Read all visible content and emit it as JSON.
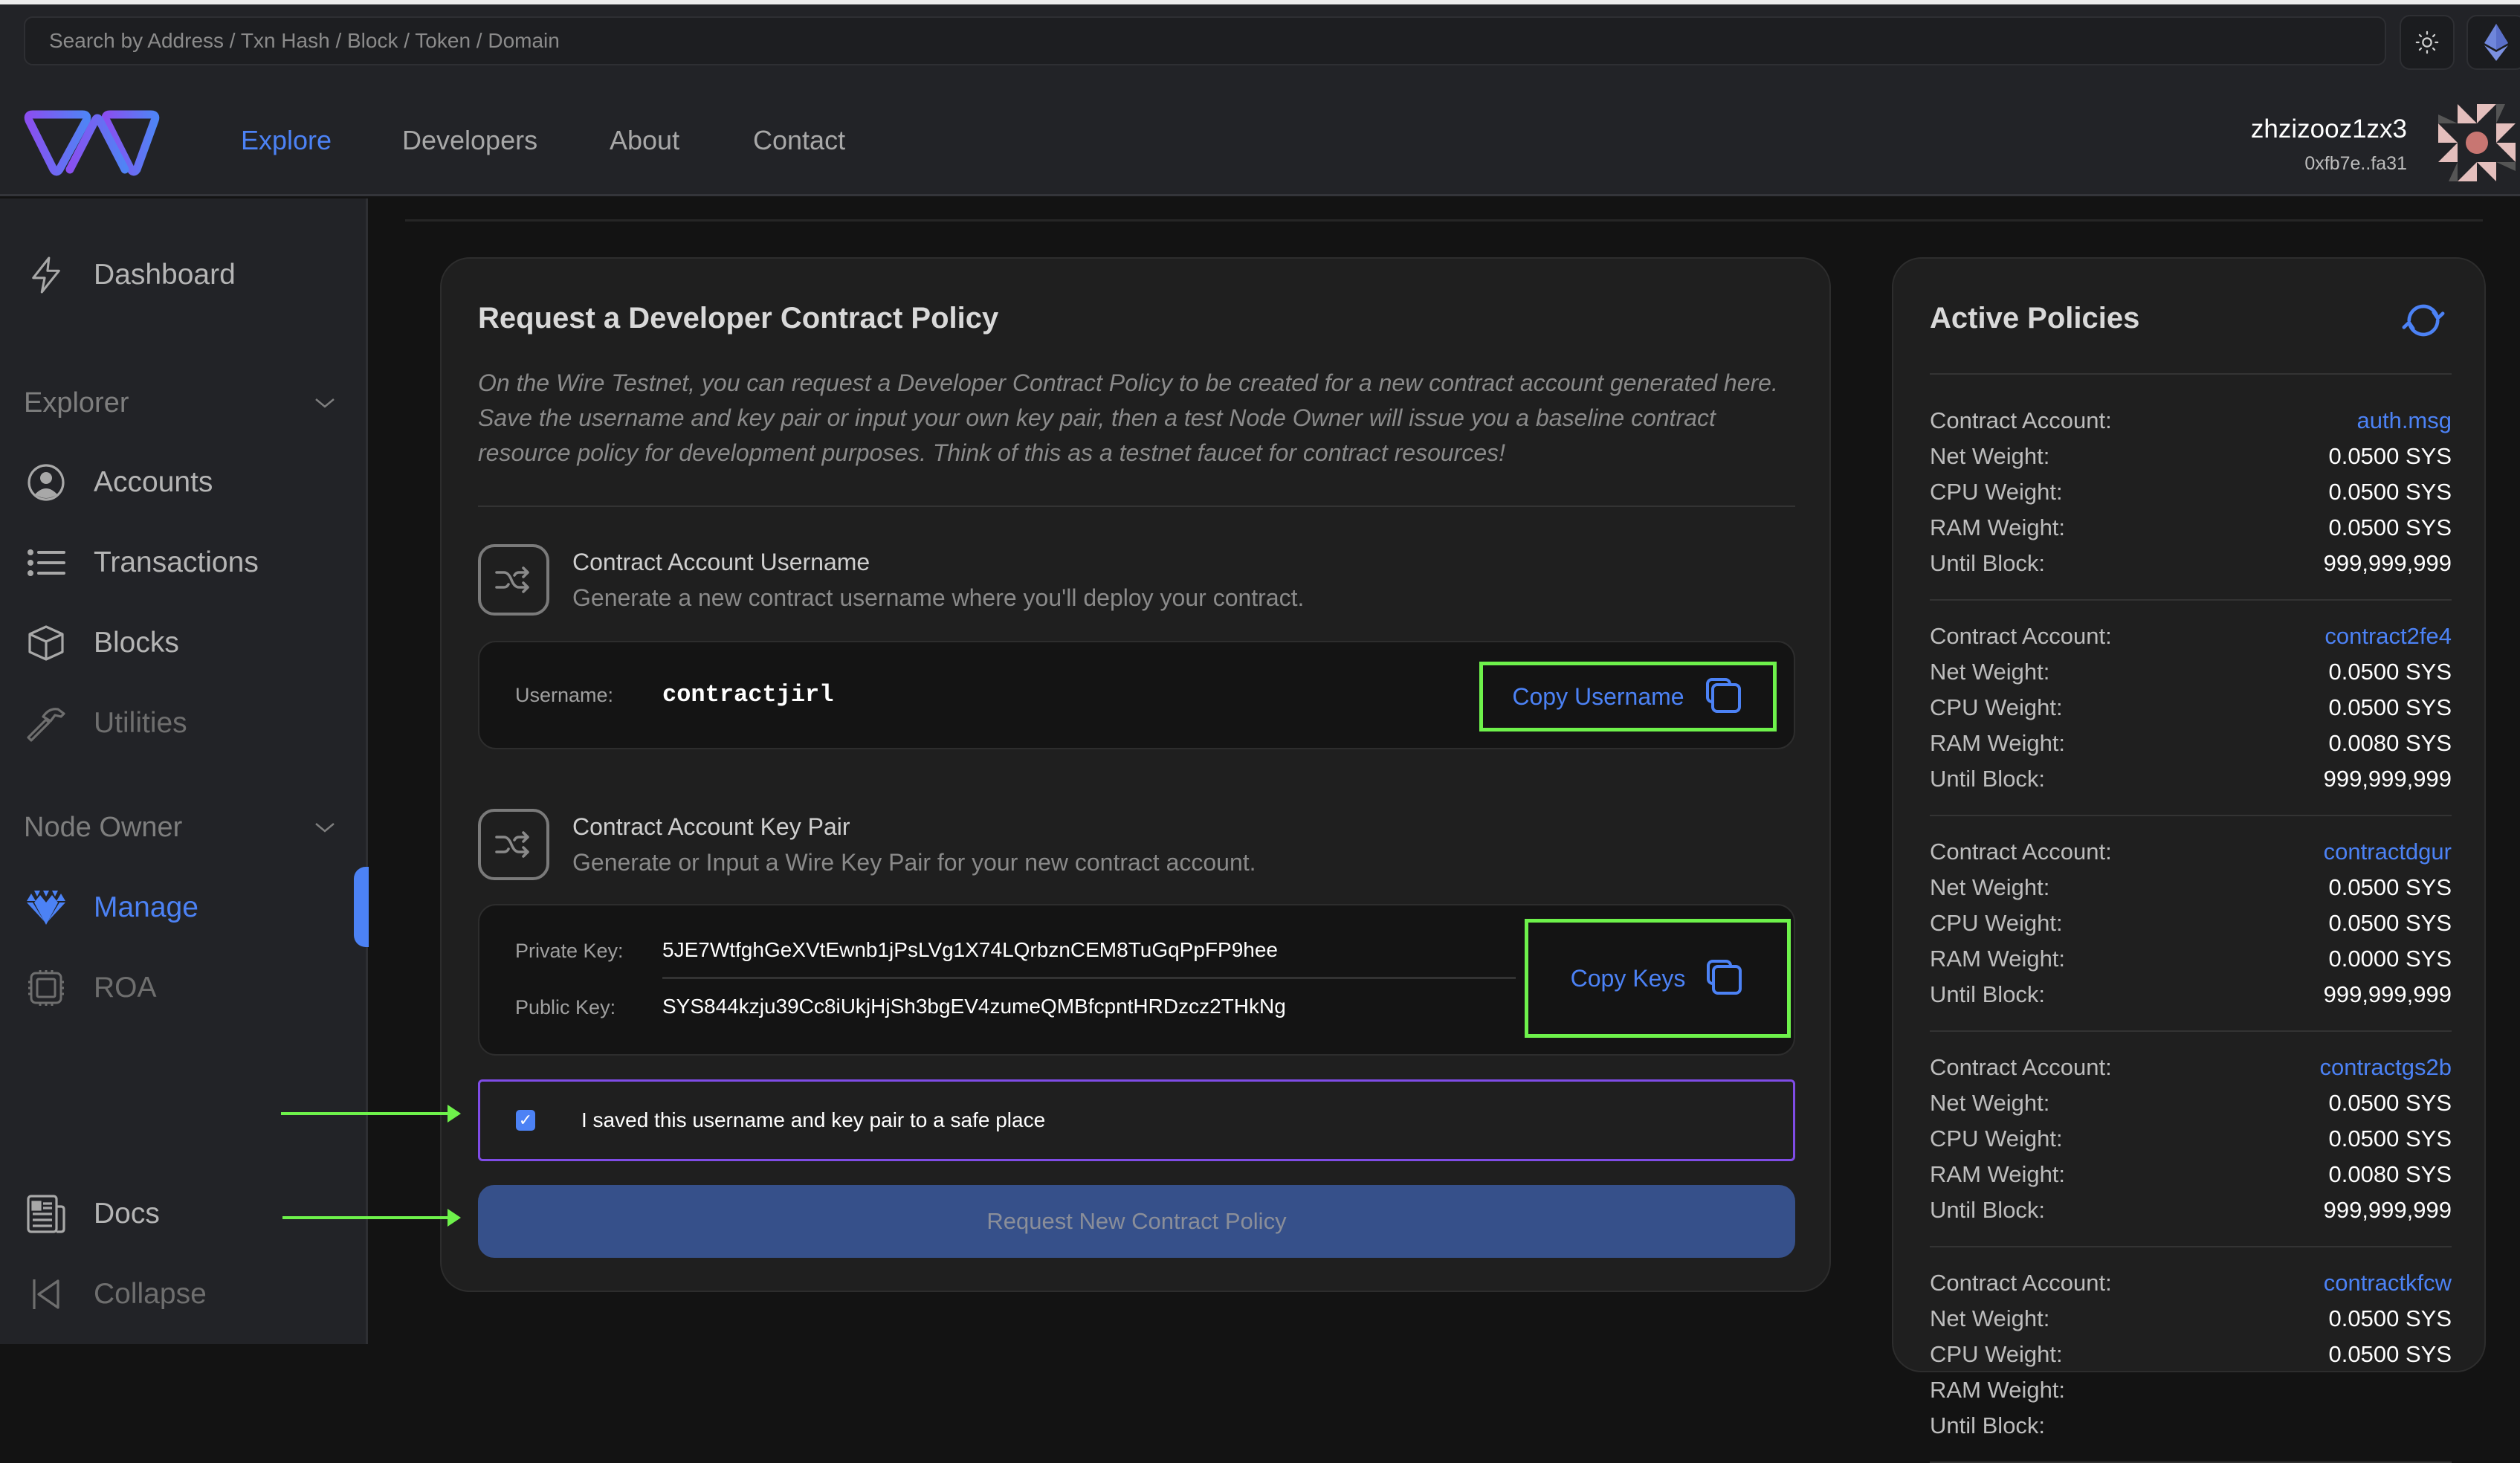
{
  "topbar": {
    "search_placeholder": "Search by Address / Txn Hash / Block / Token / Domain",
    "theme_icon": "sun-icon",
    "network_icon": "ethereum-icon"
  },
  "header": {
    "nav": [
      {
        "label": "Explore",
        "active": true
      },
      {
        "label": "Developers",
        "active": false
      },
      {
        "label": "About",
        "active": false
      },
      {
        "label": "Contact",
        "active": false
      }
    ],
    "user": {
      "name": "zhzizooz1zx3",
      "address": "0xfb7e..fa31"
    }
  },
  "sidebar": {
    "dashboard": {
      "label": "Dashboard",
      "icon": "lightning-icon"
    },
    "sections": [
      {
        "label": "Explorer",
        "items": [
          {
            "label": "Accounts",
            "icon": "user-circle-icon"
          },
          {
            "label": "Transactions",
            "icon": "list-icon"
          },
          {
            "label": "Blocks",
            "icon": "cube-icon"
          },
          {
            "label": "Utilities",
            "icon": "hammer-icon",
            "disabled": true
          }
        ]
      },
      {
        "label": "Node Owner",
        "items": [
          {
            "label": "Manage",
            "icon": "diamond-icon",
            "active": true
          },
          {
            "label": "ROA",
            "icon": "chip-icon",
            "disabled": true
          }
        ]
      }
    ],
    "docs": {
      "label": "Docs",
      "icon": "newspaper-icon"
    },
    "collapse": {
      "label": "Collapse",
      "icon": "collapse-icon"
    }
  },
  "request_card": {
    "title": "Request a Developer Contract Policy",
    "intro": "On the Wire Testnet, you can request a Developer Contract Policy to be created for a new contract account generated here. Save the username and key pair or input your own key pair, then a test Node Owner will issue you a baseline contract resource policy for development purposes. Think of this as a testnet faucet for contract resources!",
    "username_section": {
      "title": "Contract Account Username",
      "description": "Generate a new contract username where you'll deploy your contract.",
      "field_label": "Username:",
      "value": "contractjirl",
      "copy_label": "Copy Username"
    },
    "keypair_section": {
      "title": "Contract Account Key Pair",
      "description": "Generate or Input a Wire Key Pair for your new contract account.",
      "private_label": "Private Key:",
      "private_value": "5JE7WtfghGeXVtEwnb1jPsLVg1X74LQrbznCEM8TuGqPpFP9hee",
      "public_label": "Public Key:",
      "public_value": "SYS844kzju39Cc8iUkjHjSh3bgEV4zumeQMBfcpntHRDzcz2THkNg",
      "copy_label": "Copy Keys"
    },
    "confirm": {
      "label": "I saved this username and key pair to a safe place",
      "checked": true
    },
    "submit_label": "Request New Contract Policy"
  },
  "policies_card": {
    "title": "Active Policies",
    "labels": {
      "account": "Contract Account:",
      "net": "Net Weight:",
      "cpu": "CPU Weight:",
      "ram": "RAM Weight:",
      "until": "Until Block:"
    },
    "policies": [
      {
        "account": "auth.msg",
        "net": "0.0500 SYS",
        "cpu": "0.0500 SYS",
        "ram": "0.0500 SYS",
        "until": "999,999,999"
      },
      {
        "account": "contract2fe4",
        "net": "0.0500 SYS",
        "cpu": "0.0500 SYS",
        "ram": "0.0080 SYS",
        "until": "999,999,999"
      },
      {
        "account": "contractdgur",
        "net": "0.0500 SYS",
        "cpu": "0.0500 SYS",
        "ram": "0.0000 SYS",
        "until": "999,999,999"
      },
      {
        "account": "contractgs2b",
        "net": "0.0500 SYS",
        "cpu": "0.0500 SYS",
        "ram": "0.0080 SYS",
        "until": "999,999,999"
      },
      {
        "account": "contractkfcw",
        "net": "0.0500 SYS",
        "cpu": "0.0500 SYS",
        "ram": "",
        "until": ""
      }
    ]
  },
  "colors": {
    "accent": "#4c82f5",
    "annotation_green": "#6ef24b",
    "checkbox_border": "#7f4ce6",
    "button_disabled": "#36508a"
  }
}
